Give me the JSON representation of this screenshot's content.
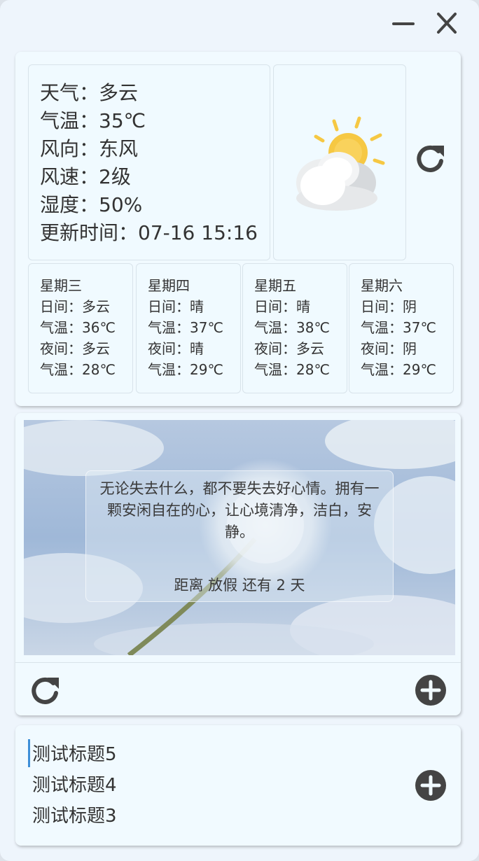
{
  "weather": {
    "current": {
      "weather": "天气：多云",
      "temperature": "气温：35℃",
      "wind_direction": "风向：东风",
      "wind_speed": "风速：2级",
      "humidity": "湿度：50%",
      "update_time": "更新时间：07-16 15:16"
    },
    "icon": "partly-cloudy-icon",
    "forecast": [
      {
        "day": "星期三",
        "day_weather": "日间：多云",
        "day_temp": "气温：36℃",
        "night_weather": "夜间：多云",
        "night_temp": "气温：28℃"
      },
      {
        "day": "星期四",
        "day_weather": "日间：晴",
        "day_temp": "气温：37℃",
        "night_weather": "夜间：晴",
        "night_temp": "气温：29℃"
      },
      {
        "day": "星期五",
        "day_weather": "日间：晴",
        "day_temp": "气温：38℃",
        "night_weather": "夜间：多云",
        "night_temp": "气温：28℃"
      },
      {
        "day": "星期六",
        "day_weather": "日间：阴",
        "day_temp": "气温：37℃",
        "night_weather": "夜间：阴",
        "night_temp": "气温：29℃"
      }
    ]
  },
  "quote": {
    "text": "无论失去什么，都不要失去好心情。拥有一颗安闲自在的心，让心境清净，洁白，安静。",
    "countdown": "距离 放假 还有 2 天"
  },
  "todos": {
    "items": [
      "测试标题5",
      "测试标题4",
      "测试标题3"
    ]
  },
  "colors": {
    "icon": "#444444",
    "accent": "#3d8fd8"
  }
}
